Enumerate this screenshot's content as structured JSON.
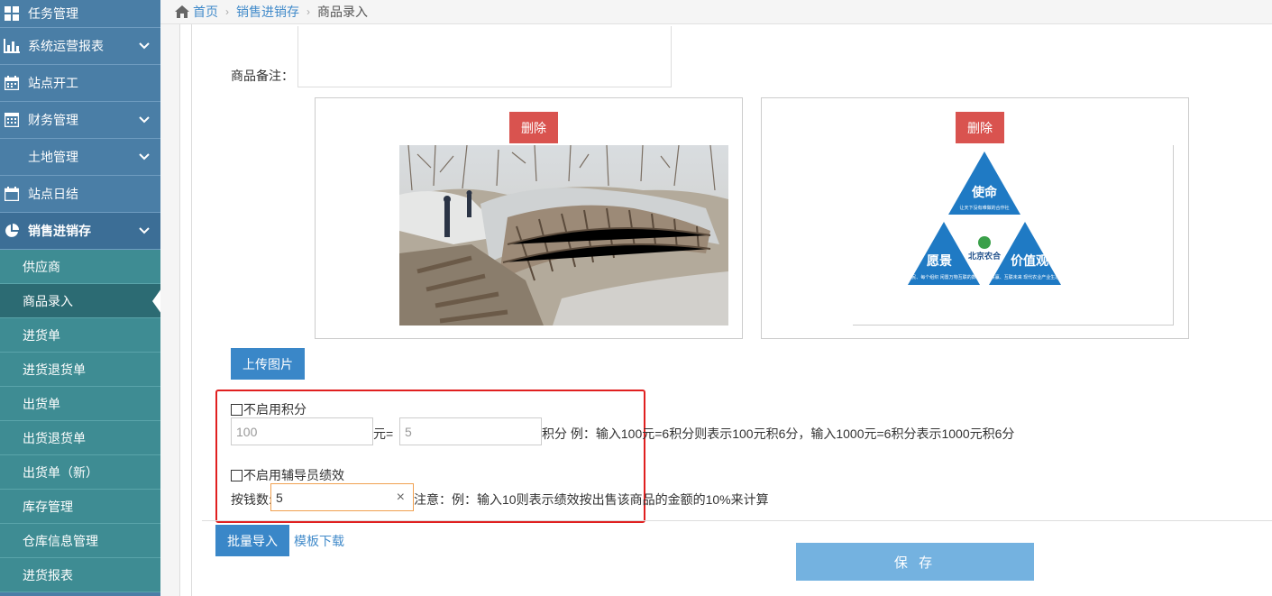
{
  "sidebar": {
    "top_items": [
      {
        "label": "任务管理",
        "icon": "grid-icon"
      },
      {
        "label": "系统运营报表",
        "icon": "bar-chart-icon"
      },
      {
        "label": "站点开工",
        "icon": "calendar-icon"
      },
      {
        "label": "财务管理",
        "icon": "calculator-icon"
      },
      {
        "label": "土地管理",
        "icon": ""
      },
      {
        "label": "站点日结",
        "icon": "calendar-icon"
      },
      {
        "label": "销售进销存",
        "icon": "pie-chart-icon"
      }
    ],
    "sub_items": [
      "供应商",
      "商品录入",
      "进货单",
      "进货退货单",
      "出货单",
      "出货退货单",
      "出货单（新）",
      "库存管理",
      "仓库信息管理",
      "进货报表"
    ],
    "active_sub": "商品录入"
  },
  "breadcrumb": {
    "home": "首页",
    "level1": "销售进销存",
    "current": "商品录入"
  },
  "form": {
    "remark_label": "商品备注：",
    "delete_label": "删除",
    "upload_label": "上传图片",
    "logo": {
      "top": "使命",
      "left": "愿景",
      "right": "价值观",
      "center": "北京农合",
      "top_sub": "让天下没有难做的合作社",
      "left_sub": "让每个农民、每个组织\n闲置万物互联的数字化世界",
      "right_sub": "合力共赢、互联未来\n现代农业产业生态平台"
    },
    "points": {
      "checkbox_label": "不启用积分",
      "amount_value": "100",
      "yuan_eq": "元=",
      "points_value": "5",
      "hint": "积分 例：输入100元=6积分则表示100元积6分，输入1000元=6积分表示1000元积6分"
    },
    "performance": {
      "checkbox_label": "不启用辅导员绩效",
      "label": "按钱数:",
      "value": "5",
      "clear": "×",
      "hint": "注意：例：输入10则表示绩效按出售该商品的金额的10%来计算"
    },
    "batch_import_label": "批量导入",
    "template_download_label": "模板下载",
    "save_label": "保 存"
  },
  "colors": {
    "sidebar": "#4a7ea6",
    "sub_menu": "#3e8c93",
    "danger": "#d9534f",
    "primary": "#3a87c8",
    "save": "#74b2e0",
    "highlight_box": "#e02020"
  }
}
